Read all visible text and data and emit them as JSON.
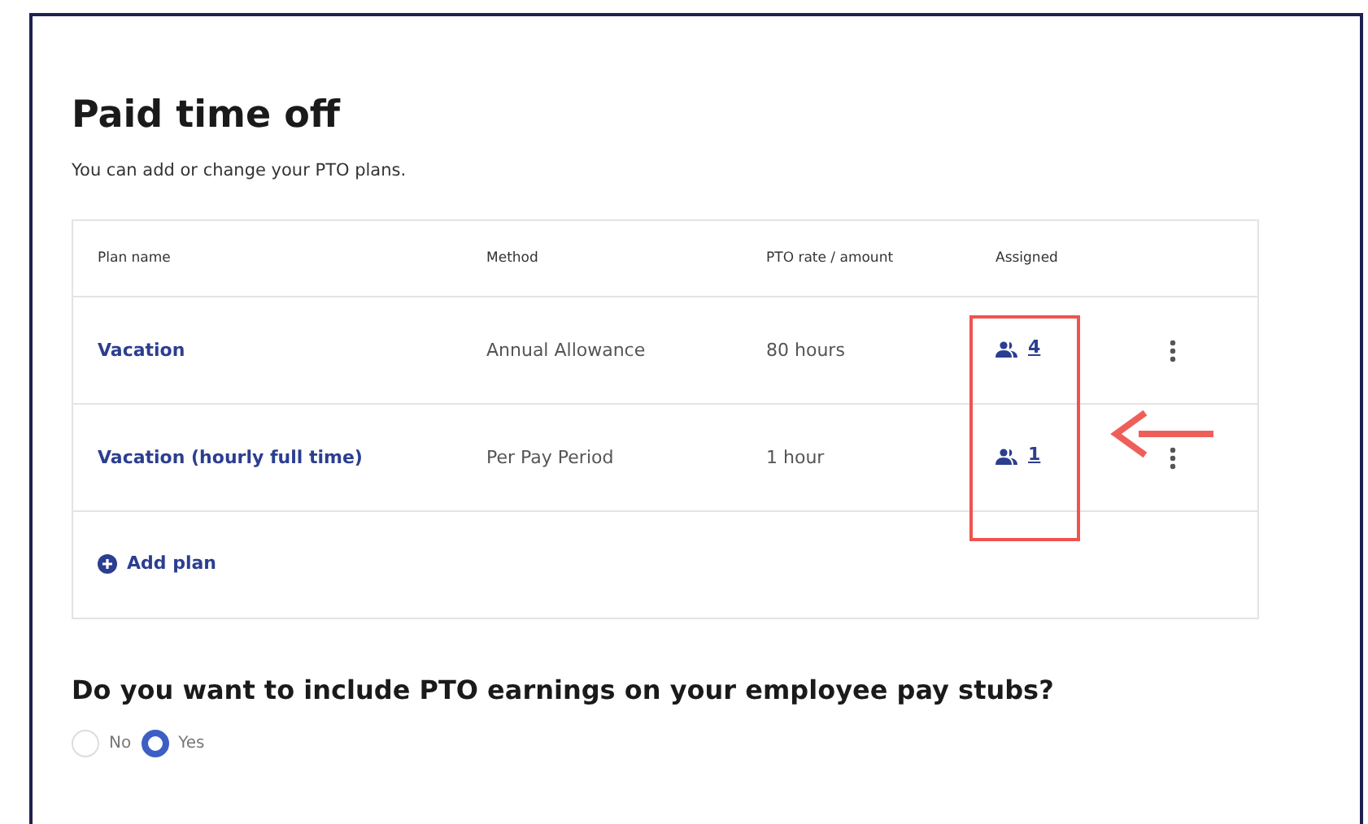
{
  "title": "Paid time off",
  "subtitle": "You can add or change your PTO plans.",
  "table": {
    "columns": [
      "Plan name",
      "Method",
      "PTO rate / amount",
      "Assigned"
    ],
    "rows": [
      {
        "plan": "Vacation",
        "method": "Annual Allowance",
        "rate": "80 hours",
        "assigned": "4"
      },
      {
        "plan": "Vacation (hourly full time)",
        "method": "Per Pay Period",
        "rate": "1 hour",
        "assigned": "1"
      }
    ],
    "add_label": "Add plan"
  },
  "question": "Do you want to include PTO earnings on your employee pay stubs?",
  "options": [
    {
      "label": "No",
      "selected": false
    },
    {
      "label": "Yes",
      "selected": true
    }
  ]
}
